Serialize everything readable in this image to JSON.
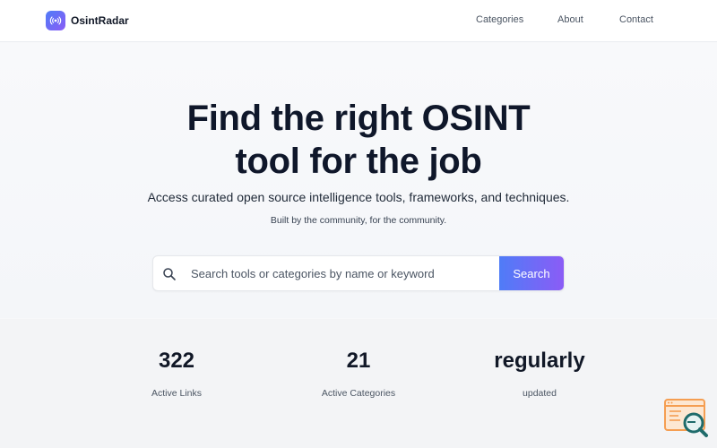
{
  "header": {
    "brand": "OsintRadar",
    "nav": [
      {
        "label": "Categories"
      },
      {
        "label": "About"
      },
      {
        "label": "Contact"
      }
    ]
  },
  "hero": {
    "title_line1": "Find the right OSINT",
    "title_line2": "tool for the job",
    "subtitle": "Access curated open source intelligence tools, frameworks, and techniques.",
    "tagline": "Built by the community, for the community."
  },
  "search": {
    "placeholder": "Search tools or categories by name or keyword",
    "button_label": "Search"
  },
  "stats": [
    {
      "value": "322",
      "label": "Active Links"
    },
    {
      "value": "21",
      "label": "Active Categories"
    },
    {
      "value": "regularly",
      "label": "updated"
    }
  ],
  "colors": {
    "accent_start": "#4f7cf7",
    "accent_end": "#8b5cf6",
    "widget_orange": "#f59e52",
    "widget_teal": "#1f6b6b"
  }
}
